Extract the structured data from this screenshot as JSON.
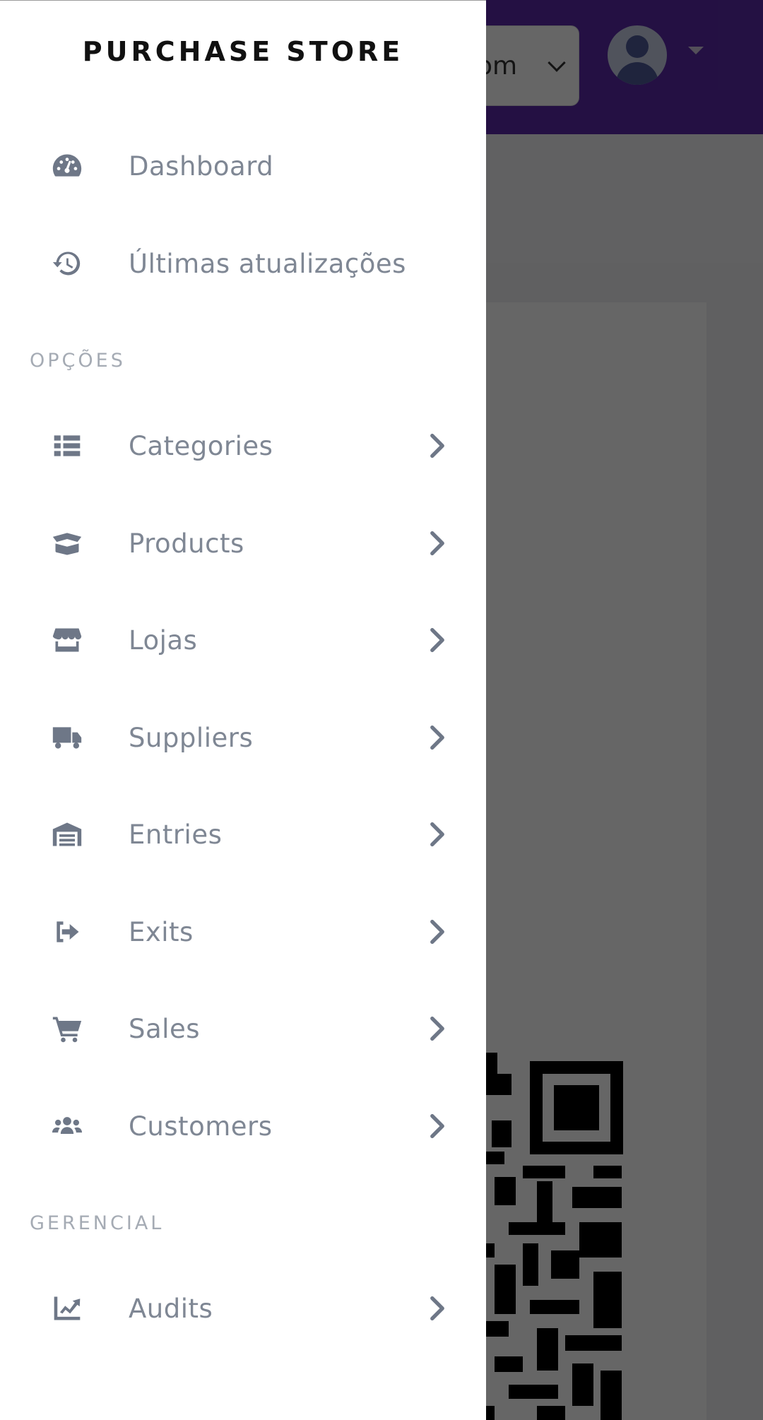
{
  "drawer": {
    "brand": "PURCHASE STORE",
    "top_items": [
      {
        "label": "Dashboard",
        "icon": "dashboard-icon"
      },
      {
        "label": "Últimas atualizações",
        "icon": "history-icon"
      }
    ],
    "sections": [
      {
        "title": "OPÇÕES",
        "items": [
          {
            "label": "Categories",
            "icon": "list-icon"
          },
          {
            "label": "Products",
            "icon": "open-box-icon"
          },
          {
            "label": "Lojas",
            "icon": "store-icon"
          },
          {
            "label": "Suppliers",
            "icon": "truck-icon"
          },
          {
            "label": "Entries",
            "icon": "warehouse-icon"
          },
          {
            "label": "Exits",
            "icon": "sign-out-icon"
          },
          {
            "label": "Sales",
            "icon": "cart-icon"
          },
          {
            "label": "Customers",
            "icon": "users-icon"
          }
        ]
      },
      {
        "title": "GERENCIAL",
        "items": [
          {
            "label": "Audits",
            "icon": "chart-line-icon"
          }
        ]
      }
    ]
  },
  "background": {
    "search_text": "om",
    "colors": {
      "topbar": "#5a2aa8",
      "drawer_bg": "#ffffff",
      "icon": "#6e7787",
      "label": "#7f8794",
      "section_title": "#a5abb4"
    }
  }
}
